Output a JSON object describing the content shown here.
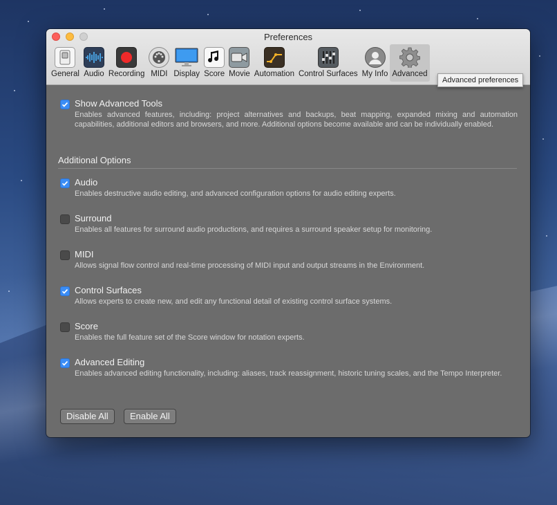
{
  "window": {
    "title": "Preferences"
  },
  "tabs": [
    {
      "label": "General",
      "icon": "switch-icon"
    },
    {
      "label": "Audio",
      "icon": "waveform-icon"
    },
    {
      "label": "Recording",
      "icon": "record-icon"
    },
    {
      "label": "MIDI",
      "icon": "midi-connector-icon"
    },
    {
      "label": "Display",
      "icon": "monitor-icon"
    },
    {
      "label": "Score",
      "icon": "music-note-icon"
    },
    {
      "label": "Movie",
      "icon": "video-camera-icon"
    },
    {
      "label": "Automation",
      "icon": "automation-curve-icon"
    },
    {
      "label": "Control Surfaces",
      "icon": "faders-icon"
    },
    {
      "label": "My Info",
      "icon": "user-icon"
    },
    {
      "label": "Advanced",
      "icon": "gear-icon",
      "selected": true
    }
  ],
  "tooltip": "Advanced preferences",
  "main_option": {
    "title": "Show Advanced Tools",
    "checked": true,
    "description": "Enables advanced features, including: project alternatives and backups, beat mapping, expanded mixing and automation capabilities, additional editors and browsers, and more. Additional options become available and can be individually enabled."
  },
  "section_label": "Additional Options",
  "options": [
    {
      "title": "Audio",
      "checked": true,
      "description": "Enables destructive audio editing, and advanced configuration options for audio editing experts."
    },
    {
      "title": "Surround",
      "checked": false,
      "description": "Enables all features for surround audio productions, and requires a surround speaker setup for monitoring."
    },
    {
      "title": "MIDI",
      "checked": false,
      "description": "Allows signal flow control and real-time processing of MIDI input and output streams in the Environment."
    },
    {
      "title": "Control Surfaces",
      "checked": true,
      "description": "Allows experts to create new, and edit any functional detail of existing control surface systems."
    },
    {
      "title": "Score",
      "checked": false,
      "description": "Enables the full feature set of the Score window for notation experts."
    },
    {
      "title": "Advanced Editing",
      "checked": true,
      "description": "Enables advanced editing functionality, including: aliases, track reassignment, historic tuning scales, and the Tempo Interpreter."
    }
  ],
  "buttons": {
    "disable_all": "Disable All",
    "enable_all": "Enable All"
  },
  "colors": {
    "accent": "#3b8df5",
    "panel": "#6c6c6c"
  }
}
